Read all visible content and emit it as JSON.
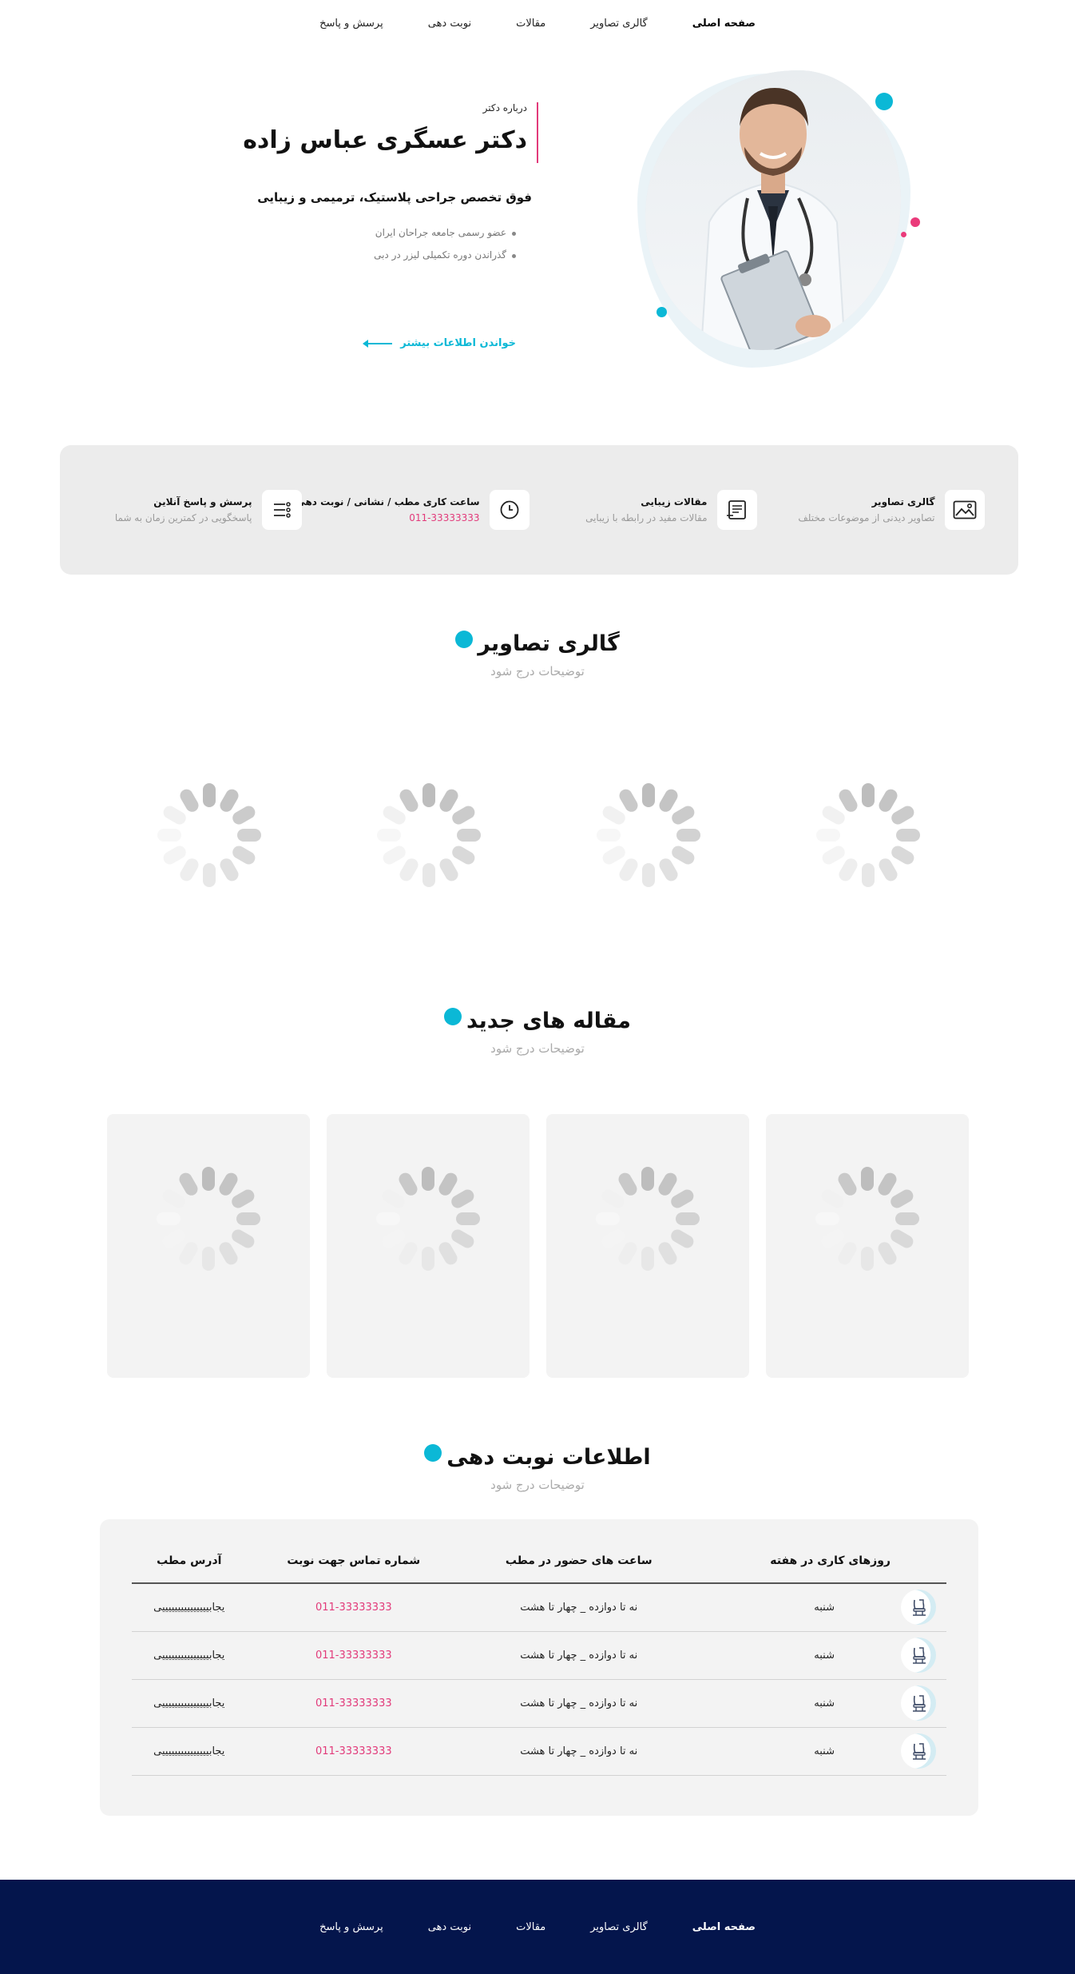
{
  "nav": {
    "items": [
      {
        "label": "صفحه اصلی"
      },
      {
        "label": "گالری تصاویر"
      },
      {
        "label": "مقالات"
      },
      {
        "label": "نوبت دهی"
      },
      {
        "label": "پرسش و پاسخ"
      }
    ]
  },
  "hero": {
    "eyebrow": "درباره دکتر",
    "name": "دکتر عسگری عباس زاده",
    "specialty": "فوق تخصص جراحی پلاستیک، ترمیمی و زیبایی",
    "bullets": [
      "عضو رسمی جامعه جراحان ایران",
      "گذراندن دوره تکمیلی لیزر در دبی"
    ],
    "read_more": "خواندن اطلاعات بیشتر"
  },
  "features": [
    {
      "title": "گالری تصاویر",
      "subtitle": "تصاویر دیدنی از موضوعات مختلف",
      "icon": "image-icon"
    },
    {
      "title": "مقالات زیبایی",
      "subtitle": "مقالات مفید در رابطه با زیبایی",
      "icon": "document-icon"
    },
    {
      "title": "ساعت کاری مطب / نشانی / نوبت دهی",
      "subtitle": "011-33333333",
      "icon": "clock-icon"
    },
    {
      "title": "پرسش و پاسخ آنلاین",
      "subtitle": "پاسخگویی در کمترین زمان به شما",
      "icon": "list-icon"
    }
  ],
  "gallery": {
    "title": "گالری تصاویر",
    "subtitle": "توضیحات درج شود"
  },
  "articles": {
    "title": "مقاله های جدید",
    "subtitle": "توضیحات درج شود"
  },
  "appointment": {
    "title": "اطلاعات نوبت دهی",
    "subtitle": "توضیحات درج شود",
    "headers": [
      "روزهای کاری در هفته",
      "ساعت های حضور در مطب",
      "شماره تماس جهت نوبت",
      "آدرس مطب"
    ],
    "rows": [
      {
        "day": "شنبه",
        "hours": "نه تا دوازده _ چهار تا هشت",
        "phone": "011-33333333",
        "address": "یجابیییییییییییییییی"
      },
      {
        "day": "شنبه",
        "hours": "نه تا دوازده _ چهار تا هشت",
        "phone": "011-33333333",
        "address": "یجابیییییییییییییییی"
      },
      {
        "day": "شنبه",
        "hours": "نه تا دوازده _ چهار تا هشت",
        "phone": "011-33333333",
        "address": "یجابیییییییییییییییی"
      },
      {
        "day": "شنبه",
        "hours": "نه تا دوازده _ چهار تا هشت",
        "phone": "011-33333333",
        "address": "یجابیییییییییییییییی"
      }
    ]
  },
  "footer": {
    "items": [
      {
        "label": "صفحه اصلی"
      },
      {
        "label": "گالری تصاویر"
      },
      {
        "label": "مقالات"
      },
      {
        "label": "نوبت دهی"
      },
      {
        "label": "پرسش و پاسخ"
      }
    ]
  },
  "colors": {
    "accent": "#0bb8d6",
    "pink": "#e23a7a",
    "footer_bg": "#04154c"
  }
}
